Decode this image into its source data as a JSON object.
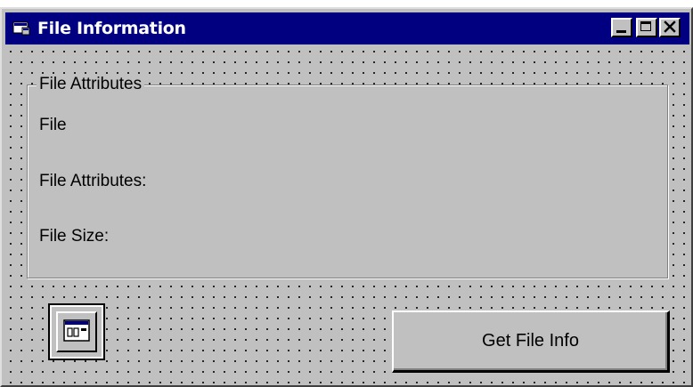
{
  "window": {
    "title": "File Information",
    "title_icon": "form-window-icon",
    "controls": {
      "minimize_icon": "minimize-icon",
      "maximize_icon": "maximize-icon",
      "close_icon": "close-icon"
    }
  },
  "frame": {
    "caption": "File Attributes",
    "labels": {
      "file": "File",
      "attributes": "File Attributes:",
      "size": "File Size:"
    }
  },
  "common_dialog_control": {
    "icon": "common-dialog-icon"
  },
  "buttons": {
    "get_file_info": "Get File Info"
  },
  "colors": {
    "titlebar": "#000080",
    "face": "#c0c0c0",
    "grid_dots": "#000000"
  }
}
